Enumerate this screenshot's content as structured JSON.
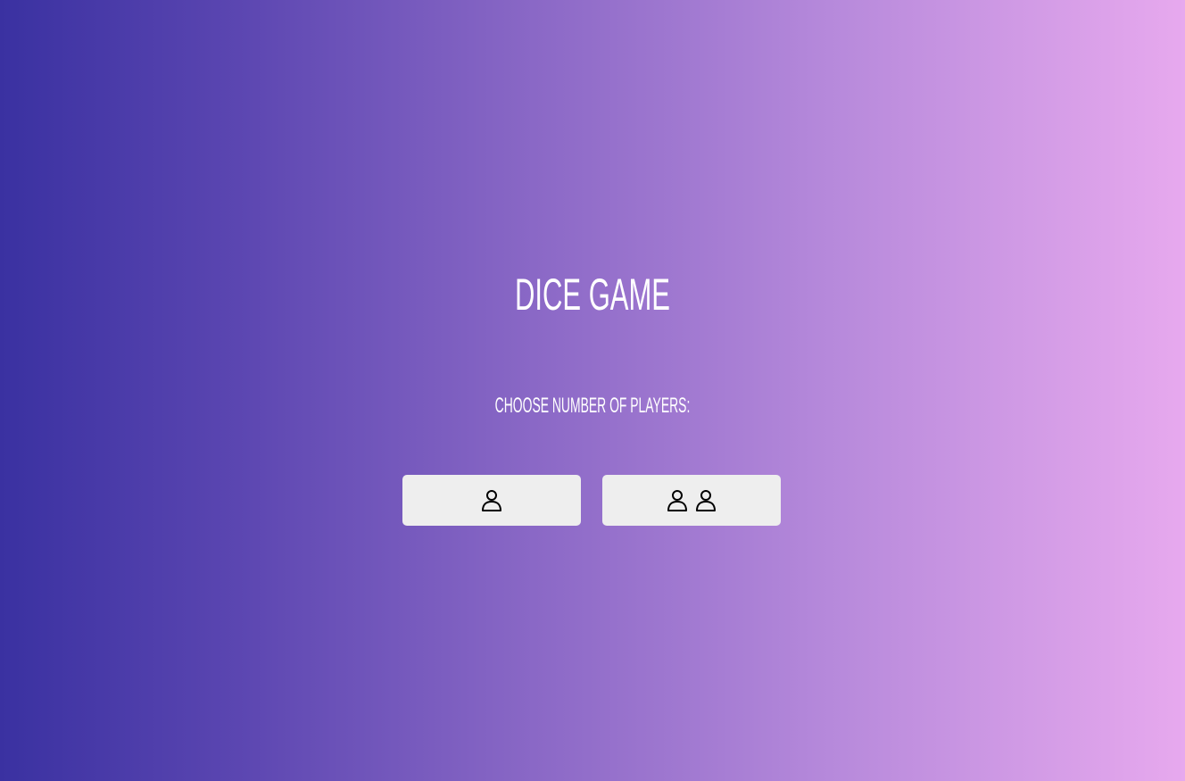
{
  "page": {
    "title": "DICE GAME",
    "subtitle": "CHOOSE NUMBER OF PLAYERS:"
  },
  "options": [
    {
      "players": 1,
      "icon": "person-icon"
    },
    {
      "players": 2,
      "icon": "person-icon"
    }
  ],
  "colors": {
    "gradient_start": "#3a31a1",
    "gradient_end": "#e7a9ee",
    "button_bg": "#eeeeee",
    "text": "#ffffff"
  }
}
